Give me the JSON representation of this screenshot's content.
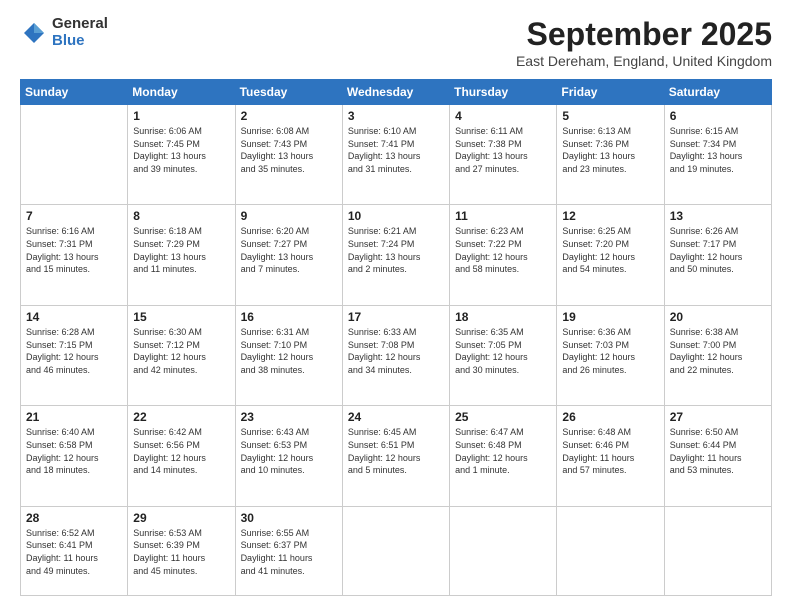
{
  "logo": {
    "general": "General",
    "blue": "Blue"
  },
  "header": {
    "month": "September 2025",
    "location": "East Dereham, England, United Kingdom"
  },
  "weekdays": [
    "Sunday",
    "Monday",
    "Tuesday",
    "Wednesday",
    "Thursday",
    "Friday",
    "Saturday"
  ],
  "weeks": [
    [
      {
        "day": "",
        "info": ""
      },
      {
        "day": "1",
        "info": "Sunrise: 6:06 AM\nSunset: 7:45 PM\nDaylight: 13 hours\nand 39 minutes."
      },
      {
        "day": "2",
        "info": "Sunrise: 6:08 AM\nSunset: 7:43 PM\nDaylight: 13 hours\nand 35 minutes."
      },
      {
        "day": "3",
        "info": "Sunrise: 6:10 AM\nSunset: 7:41 PM\nDaylight: 13 hours\nand 31 minutes."
      },
      {
        "day": "4",
        "info": "Sunrise: 6:11 AM\nSunset: 7:38 PM\nDaylight: 13 hours\nand 27 minutes."
      },
      {
        "day": "5",
        "info": "Sunrise: 6:13 AM\nSunset: 7:36 PM\nDaylight: 13 hours\nand 23 minutes."
      },
      {
        "day": "6",
        "info": "Sunrise: 6:15 AM\nSunset: 7:34 PM\nDaylight: 13 hours\nand 19 minutes."
      }
    ],
    [
      {
        "day": "7",
        "info": "Sunrise: 6:16 AM\nSunset: 7:31 PM\nDaylight: 13 hours\nand 15 minutes."
      },
      {
        "day": "8",
        "info": "Sunrise: 6:18 AM\nSunset: 7:29 PM\nDaylight: 13 hours\nand 11 minutes."
      },
      {
        "day": "9",
        "info": "Sunrise: 6:20 AM\nSunset: 7:27 PM\nDaylight: 13 hours\nand 7 minutes."
      },
      {
        "day": "10",
        "info": "Sunrise: 6:21 AM\nSunset: 7:24 PM\nDaylight: 13 hours\nand 2 minutes."
      },
      {
        "day": "11",
        "info": "Sunrise: 6:23 AM\nSunset: 7:22 PM\nDaylight: 12 hours\nand 58 minutes."
      },
      {
        "day": "12",
        "info": "Sunrise: 6:25 AM\nSunset: 7:20 PM\nDaylight: 12 hours\nand 54 minutes."
      },
      {
        "day": "13",
        "info": "Sunrise: 6:26 AM\nSunset: 7:17 PM\nDaylight: 12 hours\nand 50 minutes."
      }
    ],
    [
      {
        "day": "14",
        "info": "Sunrise: 6:28 AM\nSunset: 7:15 PM\nDaylight: 12 hours\nand 46 minutes."
      },
      {
        "day": "15",
        "info": "Sunrise: 6:30 AM\nSunset: 7:12 PM\nDaylight: 12 hours\nand 42 minutes."
      },
      {
        "day": "16",
        "info": "Sunrise: 6:31 AM\nSunset: 7:10 PM\nDaylight: 12 hours\nand 38 minutes."
      },
      {
        "day": "17",
        "info": "Sunrise: 6:33 AM\nSunset: 7:08 PM\nDaylight: 12 hours\nand 34 minutes."
      },
      {
        "day": "18",
        "info": "Sunrise: 6:35 AM\nSunset: 7:05 PM\nDaylight: 12 hours\nand 30 minutes."
      },
      {
        "day": "19",
        "info": "Sunrise: 6:36 AM\nSunset: 7:03 PM\nDaylight: 12 hours\nand 26 minutes."
      },
      {
        "day": "20",
        "info": "Sunrise: 6:38 AM\nSunset: 7:00 PM\nDaylight: 12 hours\nand 22 minutes."
      }
    ],
    [
      {
        "day": "21",
        "info": "Sunrise: 6:40 AM\nSunset: 6:58 PM\nDaylight: 12 hours\nand 18 minutes."
      },
      {
        "day": "22",
        "info": "Sunrise: 6:42 AM\nSunset: 6:56 PM\nDaylight: 12 hours\nand 14 minutes."
      },
      {
        "day": "23",
        "info": "Sunrise: 6:43 AM\nSunset: 6:53 PM\nDaylight: 12 hours\nand 10 minutes."
      },
      {
        "day": "24",
        "info": "Sunrise: 6:45 AM\nSunset: 6:51 PM\nDaylight: 12 hours\nand 5 minutes."
      },
      {
        "day": "25",
        "info": "Sunrise: 6:47 AM\nSunset: 6:48 PM\nDaylight: 12 hours\nand 1 minute."
      },
      {
        "day": "26",
        "info": "Sunrise: 6:48 AM\nSunset: 6:46 PM\nDaylight: 11 hours\nand 57 minutes."
      },
      {
        "day": "27",
        "info": "Sunrise: 6:50 AM\nSunset: 6:44 PM\nDaylight: 11 hours\nand 53 minutes."
      }
    ],
    [
      {
        "day": "28",
        "info": "Sunrise: 6:52 AM\nSunset: 6:41 PM\nDaylight: 11 hours\nand 49 minutes."
      },
      {
        "day": "29",
        "info": "Sunrise: 6:53 AM\nSunset: 6:39 PM\nDaylight: 11 hours\nand 45 minutes."
      },
      {
        "day": "30",
        "info": "Sunrise: 6:55 AM\nSunset: 6:37 PM\nDaylight: 11 hours\nand 41 minutes."
      },
      {
        "day": "",
        "info": ""
      },
      {
        "day": "",
        "info": ""
      },
      {
        "day": "",
        "info": ""
      },
      {
        "day": "",
        "info": ""
      }
    ]
  ]
}
